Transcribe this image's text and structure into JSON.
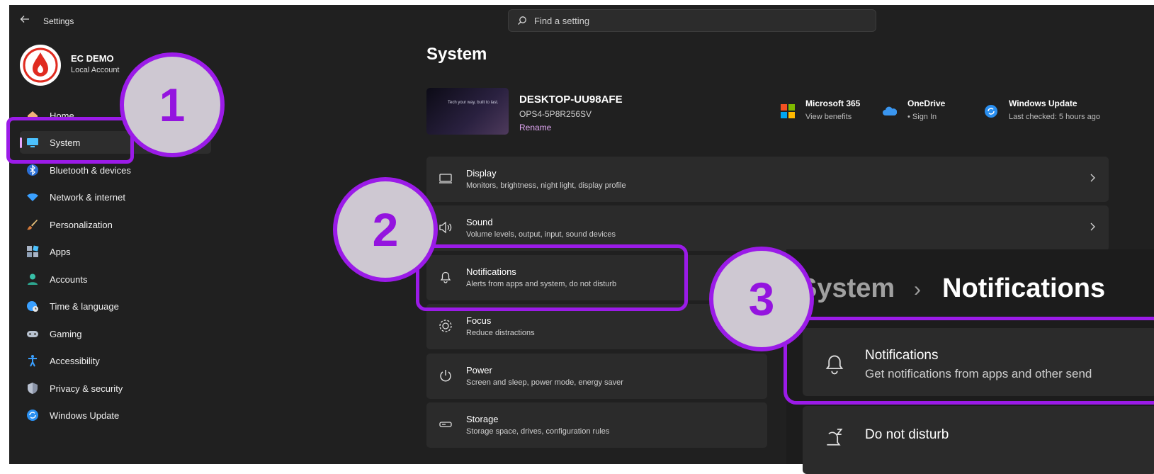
{
  "window": {
    "title": "Settings"
  },
  "search": {
    "placeholder": "Find a setting"
  },
  "user": {
    "name": "EC DEMO",
    "account_type": "Local Account"
  },
  "nav": {
    "items": [
      {
        "label": "Home",
        "icon": "home-icon"
      },
      {
        "label": "System",
        "icon": "system-display-icon",
        "selected": true
      },
      {
        "label": "Bluetooth & devices",
        "icon": "bluetooth-icon"
      },
      {
        "label": "Network & internet",
        "icon": "wifi-icon"
      },
      {
        "label": "Personalization",
        "icon": "brush-icon"
      },
      {
        "label": "Apps",
        "icon": "apps-icon"
      },
      {
        "label": "Accounts",
        "icon": "person-icon"
      },
      {
        "label": "Time & language",
        "icon": "globe-clock-icon"
      },
      {
        "label": "Gaming",
        "icon": "gamepad-icon"
      },
      {
        "label": "Accessibility",
        "icon": "accessibility-icon"
      },
      {
        "label": "Privacy & security",
        "icon": "shield-icon"
      },
      {
        "label": "Windows Update",
        "icon": "windows-update-icon"
      }
    ]
  },
  "main": {
    "title": "System",
    "device": {
      "name": "DESKTOP-UU98AFE",
      "model": "OPS4-5P8R256SV",
      "rename_label": "Rename",
      "wallpaper_text": "Tech your way, built to last."
    },
    "quick_links": [
      {
        "title": "Microsoft 365",
        "subtitle": "View benefits",
        "icon": "microsoft-logo-icon"
      },
      {
        "title": "OneDrive",
        "subtitle": "• Sign In",
        "icon": "onedrive-cloud-icon"
      },
      {
        "title": "Windows Update",
        "subtitle": "Last checked: 5 hours ago",
        "icon": "windows-update-icon"
      }
    ],
    "cards": [
      {
        "title": "Display",
        "subtitle": "Monitors, brightness, night light, display profile",
        "icon": "display-icon"
      },
      {
        "title": "Sound",
        "subtitle": "Volume levels, output, input, sound devices",
        "icon": "speaker-icon"
      },
      {
        "title": "Notifications",
        "subtitle": "Alerts from apps and system, do not disturb",
        "icon": "bell-icon"
      },
      {
        "title": "Focus",
        "subtitle": "Reduce distractions",
        "icon": "focus-icon"
      },
      {
        "title": "Power",
        "subtitle": "Screen and sleep, power mode, energy saver",
        "icon": "power-icon"
      },
      {
        "title": "Storage",
        "subtitle": "Storage space, drives, configuration rules",
        "icon": "storage-icon"
      }
    ]
  },
  "zoom": {
    "breadcrumb_parent": "System",
    "breadcrumb_separator": "›",
    "breadcrumb_current": "Notifications",
    "cards": [
      {
        "title": "Notifications",
        "subtitle": "Get notifications from apps and other send",
        "icon": "bell-icon"
      },
      {
        "title": "Do not disturb",
        "subtitle": "",
        "icon": "do-not-disturb-icon"
      }
    ]
  },
  "annotations": {
    "highlight_color": "#9b1be8",
    "steps": [
      "1",
      "2",
      "3"
    ]
  },
  "colors": {
    "background": "#202020",
    "card": "#2b2b2b",
    "accent": "#e5a7ff",
    "annotation": "#9b1be8"
  }
}
